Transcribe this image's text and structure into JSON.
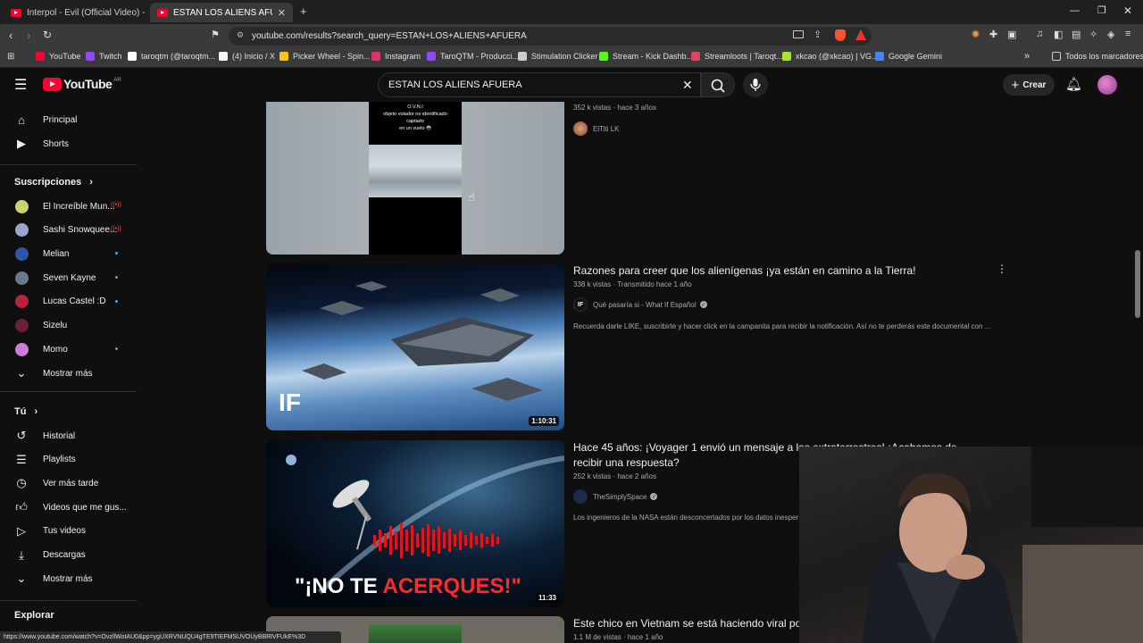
{
  "browser": {
    "tabs": [
      {
        "label": "Interpol - Evil (Official Video) - YouTu",
        "active": false
      },
      {
        "label": "ESTAN LOS ALIENS AFUERA - Yo",
        "active": true
      }
    ],
    "url": "youtube.com/results?search_query=ESTAN+LOS+ALIENS+AFUERA",
    "bookmarks": [
      {
        "label": "YouTube",
        "color": "#ff0033"
      },
      {
        "label": "Twitch",
        "color": "#9146ff"
      },
      {
        "label": "taroqtm (@taroqtm...",
        "color": "#ffffff"
      },
      {
        "label": "(4) Inicio / X",
        "color": "#ffffff"
      },
      {
        "label": "Picker Wheel - Spin...",
        "color": "#f5c518"
      },
      {
        "label": "Instagram",
        "color": "#e1306c"
      },
      {
        "label": "TaroQTM - Producci...",
        "color": "#9146ff"
      },
      {
        "label": "Stimulation Clicker",
        "color": "#cccccc"
      },
      {
        "label": "Stream - Kick Dashb...",
        "color": "#53fc18"
      },
      {
        "label": "Streamloots | Taroqt...",
        "color": "#e4405f"
      },
      {
        "label": "xkcao (@xkcao) | VG...",
        "color": "#a6e22e"
      },
      {
        "label": "Google Gemini",
        "color": "#4285f4"
      }
    ],
    "all_bookmarks": "Todos los marcadores",
    "status_url": "https://www.youtube.com/watch?v=OvzllWotAU0&pp=ygUXRVNUQU4gTE9TIEFMSUVOUyBBRlVFUkE%3D"
  },
  "header": {
    "logo": "YouTube",
    "region": "AR",
    "search_value": "ESTAN LOS ALIENS AFUERA",
    "create_label": "Crear"
  },
  "sidebar": {
    "main": [
      {
        "label": "Principal",
        "icon": "home-icon"
      },
      {
        "label": "Shorts",
        "icon": "shorts-icon"
      }
    ],
    "subs_header": "Suscripciones",
    "subscriptions": [
      {
        "label": "El Increíble Mun...",
        "color": "#c9d46a",
        "status": "live"
      },
      {
        "label": "Sashi Snowquee...",
        "color": "#9aa6c9",
        "status": "live"
      },
      {
        "label": "Melian",
        "color": "#2f55a8",
        "status": "dot"
      },
      {
        "label": "Seven Kayne",
        "color": "#6b7a8a",
        "status": "dot"
      },
      {
        "label": "Lucas Castel :D",
        "color": "#b8233b",
        "status": "dot"
      },
      {
        "label": "Sizelu",
        "color": "#6b1f3a",
        "status": ""
      },
      {
        "label": "Momo",
        "color": "#d07bd8",
        "status": "dot"
      }
    ],
    "show_more": "Mostrar más",
    "you_header": "Tú",
    "you_items": [
      {
        "label": "Historial",
        "icon": "history-icon"
      },
      {
        "label": "Playlists",
        "icon": "playlists-icon"
      },
      {
        "label": "Ver más tarde",
        "icon": "clock-icon"
      },
      {
        "label": "Videos que me gus...",
        "icon": "thumbs-up-icon"
      },
      {
        "label": "Tus videos",
        "icon": "video-icon"
      },
      {
        "label": "Descargas",
        "icon": "download-icon"
      },
      {
        "label": "Mostrar más",
        "icon": "chevron-down-icon"
      }
    ],
    "explore_header": "Explorar"
  },
  "results": [
    {
      "title": "",
      "meta": "352 k vistas · hace 3 años",
      "channel": "ElTiti LK",
      "verified": false,
      "description": "",
      "duration": "",
      "thumb_text": [
        "O.V.N.I",
        "objeto volador no identificado",
        "captado",
        "en un vuelo 😳"
      ]
    },
    {
      "title": "Razones para creer que los alienígenas ¡ya están en camino a la Tierra!",
      "meta": "338 k vistas · Transmitido hace 1 año",
      "channel": "Qué pasaría si - What If Español",
      "verified": true,
      "description": "Recuerda darle LIKE, suscribirte y hacer click en la campanita para recibir la notificación. Así no te perderás este documental con ...",
      "duration": "1:10:31",
      "thumb_text": [
        "IF"
      ]
    },
    {
      "title": "Hace 45 años: ¡Voyager 1 envió un mensaje a los extraterrestres! ¡Acabamos de recibir una respuesta?",
      "meta": "252 k vistas · hace 2 años",
      "channel": "TheSimplySpace",
      "verified": true,
      "description": "Los ingenieros de la NASA están desconcertados por los datos inesper",
      "duration": "11:33",
      "thumb_text": [
        "\"¡NO TE ",
        "ACERQUES!\""
      ]
    },
    {
      "title": "Este chico en Vietnam se está haciendo viral po",
      "meta": "1.1 M de vistas · hace 1 año",
      "channel": "",
      "verified": false,
      "description": "",
      "duration": "",
      "thumb_text": []
    }
  ]
}
